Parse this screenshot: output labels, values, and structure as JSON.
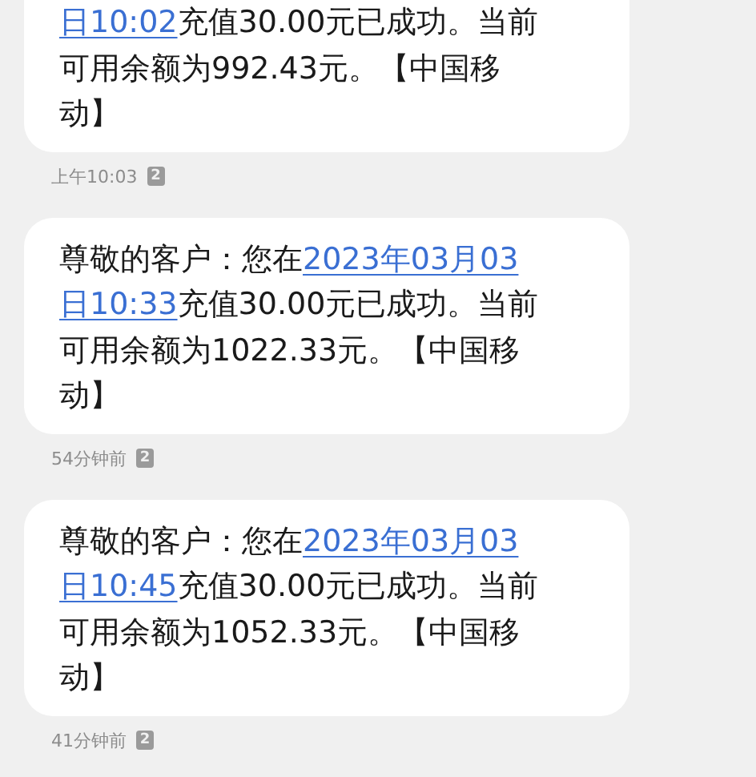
{
  "messages": [
    {
      "lines": [
        [
          {
            "text": "日10:02",
            "link": true
          },
          {
            "text": "充值30.00元已成功。当前",
            "link": false
          }
        ],
        [
          {
            "text": "可用余额为992.43元。【中国移",
            "link": false
          }
        ],
        [
          {
            "text": "动】",
            "link": false
          }
        ]
      ],
      "time": "上午10:03",
      "sim": "2"
    },
    {
      "lines": [
        [
          {
            "text": "尊敬的客户：您在",
            "link": false
          },
          {
            "text": "2023年03月03",
            "link": true
          }
        ],
        [
          {
            "text": "日10:33",
            "link": true
          },
          {
            "text": "充值30.00元已成功。当前",
            "link": false
          }
        ],
        [
          {
            "text": "可用余额为1022.33元。【中国移",
            "link": false
          }
        ],
        [
          {
            "text": "动】",
            "link": false
          }
        ]
      ],
      "time": "54分钟前",
      "sim": "2"
    },
    {
      "lines": [
        [
          {
            "text": "尊敬的客户：您在",
            "link": false
          },
          {
            "text": "2023年03月03",
            "link": true
          }
        ],
        [
          {
            "text": "日10:45",
            "link": true
          },
          {
            "text": "充值30.00元已成功。当前",
            "link": false
          }
        ],
        [
          {
            "text": "可用余额为1052.33元。【中国移",
            "link": false
          }
        ],
        [
          {
            "text": "动】",
            "link": false
          }
        ]
      ],
      "time": "41分钟前",
      "sim": "2"
    }
  ]
}
